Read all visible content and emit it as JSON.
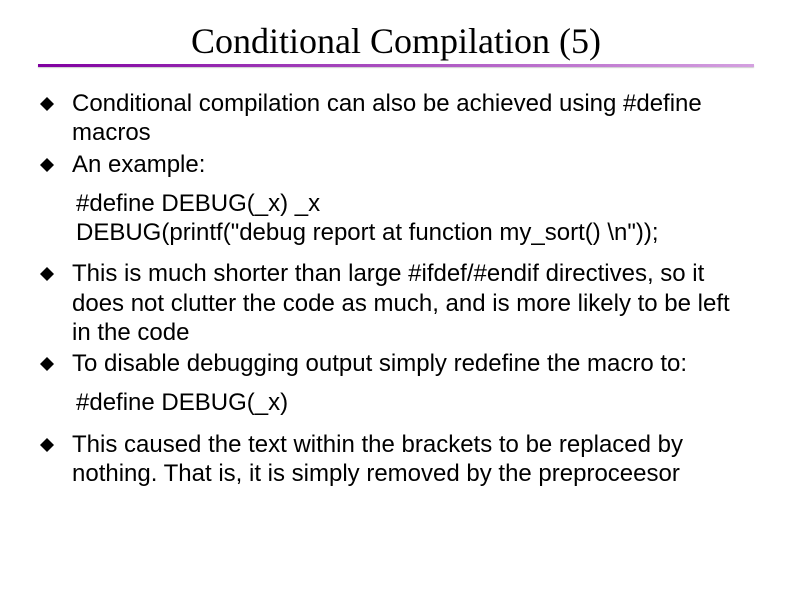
{
  "title": "Conditional Compilation (5)",
  "bullets": {
    "b1": "Conditional compilation can also be achieved using #define macros",
    "b2": "An example:",
    "b3": "This is much shorter than large #ifdef/#endif directives, so it does not clutter the code as much, and is more likely to be left in the code",
    "b4": "To disable debugging output simply redefine the macro to:",
    "b5": "This caused the text within the brackets to be replaced by nothing. That is, it is simply removed by the preproceesor"
  },
  "code1": {
    "line1": "#define DEBUG(_x) _x",
    "line2": "DEBUG(printf(\"debug report at function my_sort() \\n\"));"
  },
  "code2": {
    "line1": "#define DEBUG(_x)"
  }
}
